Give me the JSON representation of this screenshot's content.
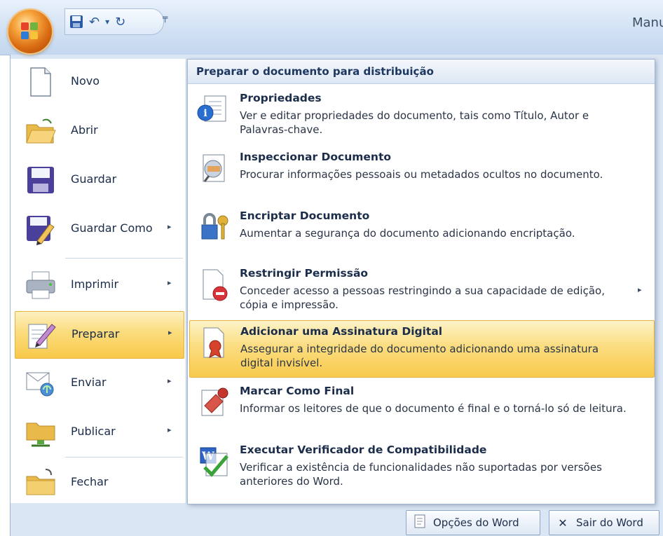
{
  "titlebar": {
    "window_title": "Manu",
    "office_button_icon": "office-orb-icon",
    "quick_access": [
      {
        "name": "save-icon",
        "glyph": "💾"
      },
      {
        "name": "undo-icon",
        "glyph": "↶"
      },
      {
        "name": "undo-dropdown-icon",
        "glyph": "▾"
      },
      {
        "name": "redo-icon",
        "glyph": "↻"
      }
    ],
    "customize_glyph": "╤"
  },
  "left_menu": {
    "items": [
      {
        "label": "Novo",
        "icon": "new-document-icon",
        "has_submenu": false
      },
      {
        "label": "Abrir",
        "icon": "open-folder-icon",
        "has_submenu": false
      },
      {
        "label": "Guardar",
        "icon": "save-icon",
        "has_submenu": false
      },
      {
        "label": "Guardar Como",
        "icon": "save-as-icon",
        "has_submenu": true
      },
      {
        "label": "Imprimir",
        "icon": "printer-icon",
        "has_submenu": true
      },
      {
        "label": "Preparar",
        "icon": "prepare-icon",
        "has_submenu": true,
        "active": true
      },
      {
        "label": "Enviar",
        "icon": "send-icon",
        "has_submenu": true
      },
      {
        "label": "Publicar",
        "icon": "publish-icon",
        "has_submenu": true
      },
      {
        "label": "Fechar",
        "icon": "close-folder-icon",
        "has_submenu": false
      }
    ],
    "submenu_arrow": "▸"
  },
  "submenu": {
    "header": "Preparar o documento para distribuição",
    "options": [
      {
        "title": "Propriedades",
        "description": "Ver e editar propriedades do documento, tais como Título, Autor e Palavras-chave.",
        "icon": "properties-icon"
      },
      {
        "title": "Inspeccionar Documento",
        "description": "Procurar informações pessoais ou metadados ocultos no documento.",
        "icon": "inspect-document-icon"
      },
      {
        "title": "Encriptar Documento",
        "description": "Aumentar a segurança do documento adicionando encriptação.",
        "icon": "encrypt-lock-icon"
      },
      {
        "title": "Restringir Permissão",
        "description": "Conceder acesso a pessoas restringindo a sua capacidade de edição, cópia e impressão.",
        "icon": "restrict-permission-icon",
        "has_submenu": true
      },
      {
        "title": "Adicionar uma Assinatura Digital",
        "description": "Assegurar a integridade do documento adicionando uma assinatura digital invisível.",
        "icon": "digital-signature-icon",
        "active": true
      },
      {
        "title": "Marcar Como Final",
        "description": "Informar os leitores de que o documento é final e o torná-lo só de leitura.",
        "icon": "mark-final-icon"
      },
      {
        "title": "Executar Verificador de Compatibilidade",
        "description": "Verificar a existência de funcionalidades não suportadas por versões anteriores do Word.",
        "icon": "compatibility-checker-icon"
      }
    ]
  },
  "footer": {
    "options_button": "Opções do Word",
    "exit_button": "Sair do Word"
  },
  "colors": {
    "highlight": "#f8c94a",
    "menu_background": "#dbe6f4",
    "title_text": "#1d3760"
  }
}
